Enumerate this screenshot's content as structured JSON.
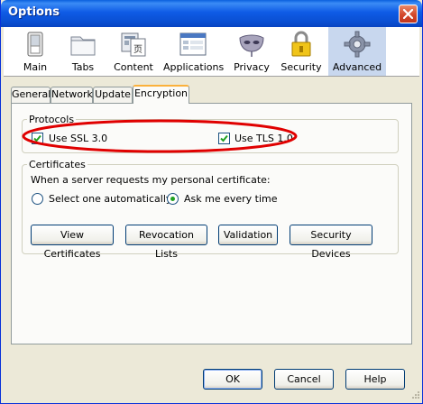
{
  "window": {
    "title": "Options"
  },
  "toolbar": {
    "items": [
      {
        "label": "Main"
      },
      {
        "label": "Tabs"
      },
      {
        "label": "Content"
      },
      {
        "label": "Applications"
      },
      {
        "label": "Privacy"
      },
      {
        "label": "Security"
      },
      {
        "label": "Advanced"
      }
    ],
    "selected": "Advanced"
  },
  "tabs": [
    {
      "label": "General"
    },
    {
      "label": "Network"
    },
    {
      "label": "Update"
    },
    {
      "label": "Encryption"
    }
  ],
  "active_tab": "Encryption",
  "protocols": {
    "group_label": "Protocols",
    "ssl_label": "Use SSL 3.0",
    "ssl_checked": true,
    "tls_label": "Use TLS 1.0",
    "tls_checked": true
  },
  "certificates": {
    "group_label": "Certificates",
    "prompt": "When a server requests my personal certificate:",
    "option_auto": "Select one automatically",
    "option_ask": "Ask me every time",
    "selected_option": "Ask me every time",
    "buttons": {
      "view": "View Certificates",
      "revocation": "Revocation Lists",
      "validation": "Validation",
      "devices": "Security Devices"
    }
  },
  "footer": {
    "ok": "OK",
    "cancel": "Cancel",
    "help": "Help"
  },
  "colors": {
    "highlight_ellipse": "#e00000",
    "selected_toolbar_bg": "#c8d7ee",
    "active_tab_accent": "#fbb13c"
  }
}
